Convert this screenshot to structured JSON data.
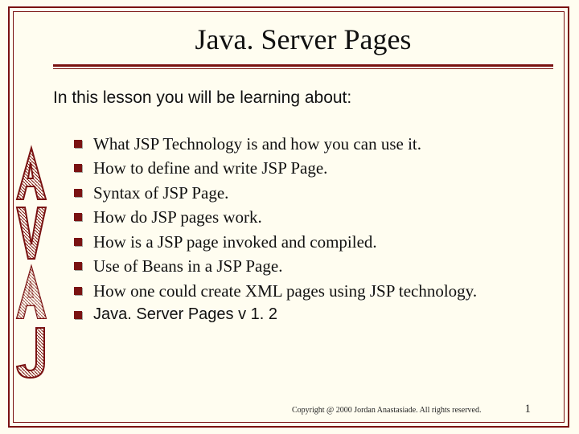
{
  "title": "Java. Server Pages",
  "intro": "In this lesson you will be learning about:",
  "bullets": [
    "What JSP Technology is and how you can use it.",
    "How to define and write JSP Page.",
    "Syntax of JSP Page.",
    "How do JSP pages work.",
    "How is a JSP page invoked and compiled.",
    "Use of Beans in a JSP Page.",
    "How one could create XML pages using JSP technology.",
    "Java. Server Pages v 1. 2"
  ],
  "footer": {
    "copyright": "Copyright @ 2000 Jordan Anastasiade. All rights reserved.",
    "page": "1"
  },
  "side_text": "JAVA",
  "colors": {
    "accent": "#7a1212",
    "bg": "#fffdf0"
  }
}
